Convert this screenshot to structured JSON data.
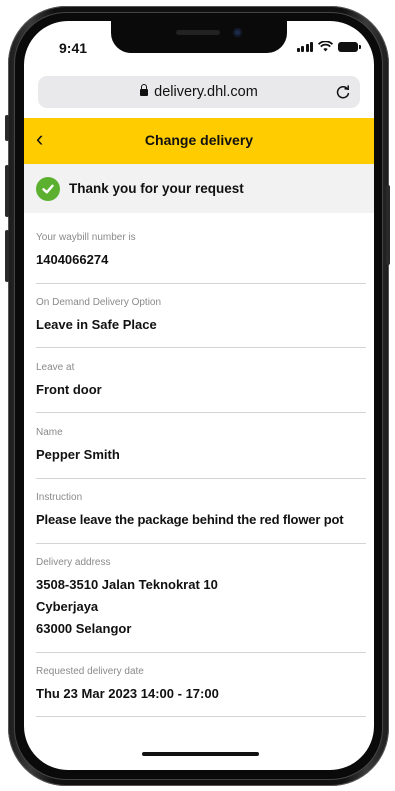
{
  "status_bar": {
    "time": "9:41"
  },
  "browser": {
    "url": "delivery.dhl.com"
  },
  "header": {
    "back_glyph": "‹",
    "title": "Change delivery"
  },
  "banner": {
    "message": "Thank you for your request"
  },
  "fields": [
    {
      "label": "Your waybill number is",
      "value": "1404066274"
    },
    {
      "label": "On Demand Delivery Option",
      "value": "Leave in Safe Place"
    },
    {
      "label": "Leave at",
      "value": "Front door"
    },
    {
      "label": "Name",
      "value": "Pepper Smith"
    },
    {
      "label": "Instruction",
      "value": "Please leave the package behind the red flower pot"
    },
    {
      "label": "Delivery address",
      "lines": [
        "3508-3510 Jalan Teknokrat 10",
        "Cyberjaya",
        "63000 Selangor"
      ]
    },
    {
      "label": "Requested delivery date",
      "value": "Thu 23 Mar 2023 14:00 - 17:00"
    }
  ],
  "colors": {
    "brand_yellow": "#ffcc00",
    "success_green": "#5cb030",
    "banner_bg": "#f2f2f2"
  },
  "icons": [
    "lock-icon",
    "reload-icon",
    "back-icon",
    "check-circle-icon",
    "signal-icon",
    "wifi-icon",
    "battery-icon"
  ]
}
